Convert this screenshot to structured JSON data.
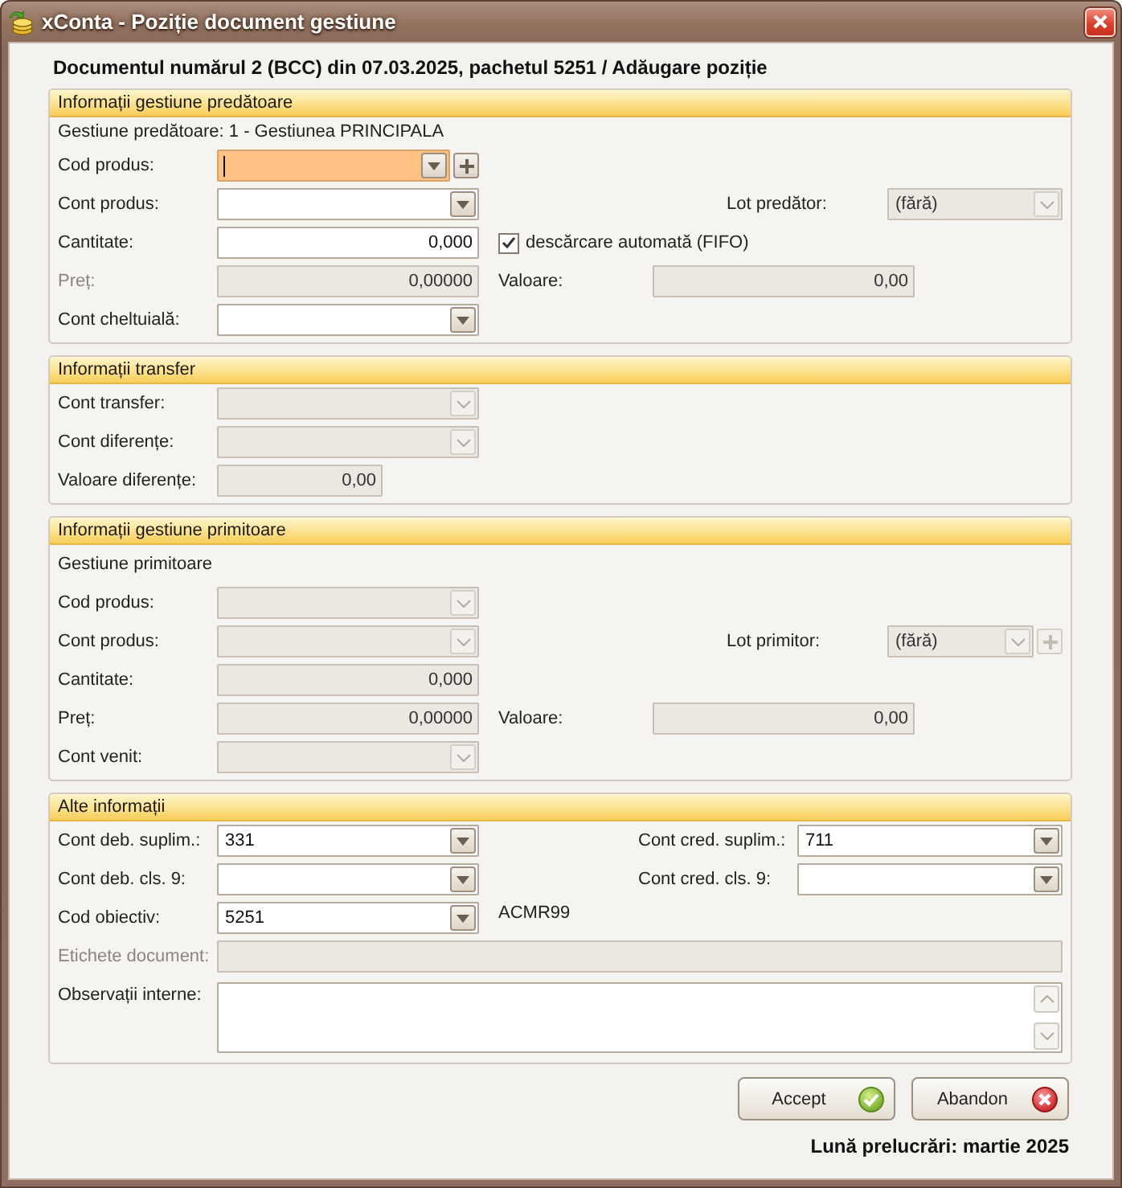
{
  "window": {
    "title": "xConta - Poziție document gestiune"
  },
  "heading": "Documentul numărul 2 (BCC) din 07.03.2025, pachetul 5251 / Adăugare poziție",
  "groups": [
    {
      "title": "Informații gestiune predătoare",
      "rows": [
        {
          "kind": "info",
          "text": "Gestiune predătoare: 1 - Gestiunea PRINCIPALA"
        },
        {
          "kind": "fields",
          "items": [
            {
              "kind": "field",
              "label": "Cod produs:",
              "label_disabled": false,
              "field": {
                "kind": "combo",
                "disabled": false,
                "focused": true,
                "add_button": true
              }
            }
          ]
        },
        {
          "kind": "fields",
          "items": [
            {
              "kind": "field",
              "label": "Cont produs:",
              "label_disabled": false,
              "field": {
                "kind": "combo",
                "disabled": false,
                "focused": false,
                "add_button": false
              }
            },
            {
              "kind": "lot",
              "label": "Lot predător:",
              "label_disabled": false,
              "field": {
                "kind": "combo",
                "value": "(fără)",
                "disabled": true,
                "focused": false,
                "add_button": false
              }
            }
          ]
        },
        {
          "kind": "fields",
          "items": [
            {
              "kind": "field",
              "label": "Cantitate:",
              "label_disabled": false,
              "field": {
                "kind": "number",
                "value": "0,000",
                "disabled": false,
                "focused": false,
                "add_button": false
              }
            },
            {
              "kind": "checkbox",
              "label": "descărcare automată (FIFO)",
              "checked": true
            }
          ]
        },
        {
          "kind": "fields",
          "items": [
            {
              "kind": "field",
              "label": "Preț:",
              "label_disabled": true,
              "field": {
                "kind": "number",
                "value": "0,00000",
                "disabled": true,
                "focused": false,
                "add_button": false
              }
            },
            {
              "kind": "value",
              "label": "Valoare:",
              "label_disabled": false,
              "field": {
                "kind": "number",
                "value": "0,00",
                "disabled": true,
                "focused": false,
                "add_button": false
              }
            }
          ]
        },
        {
          "kind": "fields",
          "items": [
            {
              "kind": "field",
              "label": "Cont cheltuială:",
              "label_disabled": false,
              "field": {
                "kind": "combo",
                "disabled": false,
                "focused": false,
                "add_button": false
              }
            }
          ]
        }
      ]
    },
    {
      "title": "Informații transfer",
      "rows": [
        {
          "kind": "fields",
          "items": [
            {
              "kind": "field",
              "label": "Cont transfer:",
              "label_disabled": false,
              "field": {
                "kind": "combo",
                "disabled": true,
                "focused": false,
                "add_button": false
              }
            }
          ]
        },
        {
          "kind": "fields",
          "items": [
            {
              "kind": "field",
              "label": "Cont diferențe:",
              "label_disabled": false,
              "field": {
                "kind": "combo",
                "disabled": true,
                "focused": false,
                "add_button": false
              }
            }
          ]
        },
        {
          "kind": "fields",
          "items": [
            {
              "kind": "short",
              "label": "Valoare diferențe:",
              "label_disabled": false,
              "field": {
                "kind": "number",
                "value": "0,00",
                "disabled": true,
                "focused": false,
                "add_button": false
              }
            }
          ]
        }
      ]
    },
    {
      "title": "Informații gestiune primitoare",
      "rows": [
        {
          "kind": "label",
          "text": "Gestiune primitoare"
        },
        {
          "kind": "fields",
          "items": [
            {
              "kind": "field",
              "label": "Cod produs:",
              "label_disabled": false,
              "field": {
                "kind": "combo",
                "disabled": true,
                "focused": false,
                "add_button": false
              }
            }
          ]
        },
        {
          "kind": "fields",
          "items": [
            {
              "kind": "field",
              "label": "Cont produs:",
              "label_disabled": false,
              "field": {
                "kind": "combo",
                "disabled": true,
                "focused": false,
                "add_button": false
              }
            },
            {
              "kind": "lot",
              "label": "Lot primitor:",
              "label_disabled": false,
              "field": {
                "kind": "combo",
                "value": "(fără)",
                "disabled": true,
                "focused": false,
                "add_button": true
              }
            }
          ]
        },
        {
          "kind": "fields",
          "items": [
            {
              "kind": "field",
              "label": "Cantitate:",
              "label_disabled": false,
              "field": {
                "kind": "number",
                "value": "0,000",
                "disabled": true,
                "focused": false,
                "add_button": false
              }
            }
          ]
        },
        {
          "kind": "fields",
          "items": [
            {
              "kind": "field",
              "label": "Preț:",
              "label_disabled": false,
              "field": {
                "kind": "number",
                "value": "0,00000",
                "disabled": true,
                "focused": false,
                "add_button": false
              }
            },
            {
              "kind": "value",
              "label": "Valoare:",
              "label_disabled": false,
              "field": {
                "kind": "number",
                "value": "0,00",
                "disabled": true,
                "focused": false,
                "add_button": false
              }
            }
          ]
        },
        {
          "kind": "fields",
          "items": [
            {
              "kind": "field",
              "label": "Cont venit:",
              "label_disabled": false,
              "field": {
                "kind": "combo",
                "disabled": true,
                "focused": false,
                "add_button": false
              }
            }
          ]
        }
      ]
    },
    {
      "title": "Alte informații",
      "rows": [
        {
          "kind": "fields",
          "items": [
            {
              "kind": "field",
              "label": "Cont deb. suplim.:",
              "label_disabled": false,
              "field": {
                "kind": "combo",
                "value": "331",
                "disabled": false,
                "focused": false,
                "add_button": false
              }
            },
            {
              "kind": "paired",
              "label": "Cont cred. suplim.:",
              "label_disabled": false,
              "field": {
                "kind": "combo",
                "value": "711",
                "disabled": false,
                "focused": false,
                "add_button": false
              }
            }
          ]
        },
        {
          "kind": "fields",
          "items": [
            {
              "kind": "field",
              "label": "Cont deb. cls. 9:",
              "label_disabled": false,
              "field": {
                "kind": "combo",
                "disabled": false,
                "focused": false,
                "add_button": false
              }
            },
            {
              "kind": "paired",
              "label": "Cont cred. cls. 9:",
              "label_disabled": false,
              "field": {
                "kind": "combo",
                "disabled": false,
                "focused": false,
                "add_button": false
              }
            }
          ]
        },
        {
          "kind": "fields",
          "items": [
            {
              "kind": "field",
              "label": "Cod obiectiv:",
              "label_disabled": false,
              "field": {
                "kind": "combo",
                "value": "5251",
                "disabled": false,
                "focused": false,
                "add_button": false
              }
            },
            {
              "kind": "note",
              "text": "ACMR99"
            }
          ]
        },
        {
          "kind": "fields",
          "items": [
            {
              "kind": "wide",
              "label": "Etichete document:",
              "label_disabled": true,
              "field": {
                "kind": "text",
                "disabled": true,
                "focused": false,
                "add_button": false
              }
            }
          ]
        },
        {
          "kind": "fields",
          "items": [
            {
              "kind": "wide",
              "label": "Observații interne:",
              "label_disabled": false,
              "field": {
                "kind": "memo",
                "disabled": false,
                "focused": false,
                "add_button": false
              }
            }
          ]
        }
      ]
    }
  ],
  "buttons": [
    {
      "kind": "accept",
      "label": "Accept"
    },
    {
      "kind": "cancel",
      "label": "Abandon"
    }
  ],
  "status": "Lună prelucrări: martie 2025"
}
